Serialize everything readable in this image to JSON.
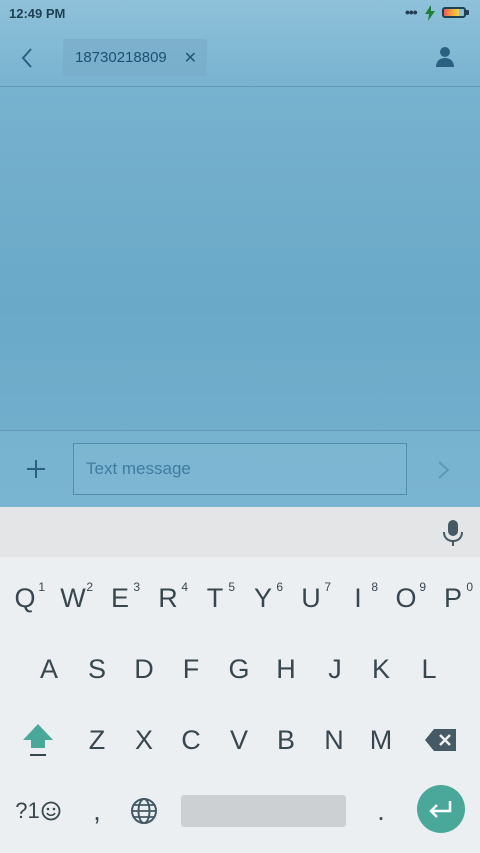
{
  "status_bar": {
    "time": "12:49 PM",
    "battery_level": 0.75
  },
  "header": {
    "recipient": "18730218809"
  },
  "compose": {
    "placeholder": "Text message"
  },
  "keyboard": {
    "row1": [
      {
        "key": "Q",
        "hint": "1"
      },
      {
        "key": "W",
        "hint": "2"
      },
      {
        "key": "E",
        "hint": "3"
      },
      {
        "key": "R",
        "hint": "4"
      },
      {
        "key": "T",
        "hint": "5"
      },
      {
        "key": "Y",
        "hint": "6"
      },
      {
        "key": "U",
        "hint": "7"
      },
      {
        "key": "I",
        "hint": "8"
      },
      {
        "key": "O",
        "hint": "9"
      },
      {
        "key": "P",
        "hint": "0"
      }
    ],
    "row2": [
      "A",
      "S",
      "D",
      "F",
      "G",
      "H",
      "J",
      "K",
      "L"
    ],
    "row3": [
      "Z",
      "X",
      "C",
      "V",
      "B",
      "N",
      "M"
    ],
    "symbols_key": "?1",
    "comma_key": ",",
    "period_key": "."
  },
  "colors": {
    "accent": "#4aa89a",
    "bar_text": "#1d5174"
  }
}
